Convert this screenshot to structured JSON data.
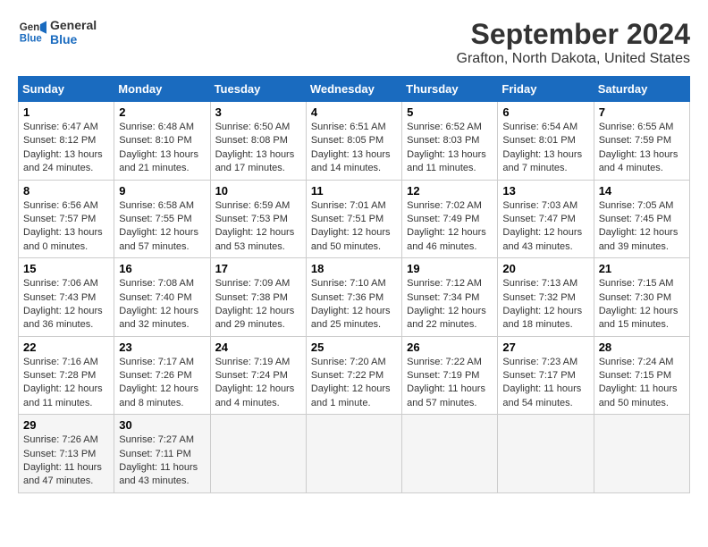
{
  "header": {
    "logo_line1": "General",
    "logo_line2": "Blue",
    "title": "September 2024",
    "subtitle": "Grafton, North Dakota, United States"
  },
  "days_of_week": [
    "Sunday",
    "Monday",
    "Tuesday",
    "Wednesday",
    "Thursday",
    "Friday",
    "Saturday"
  ],
  "weeks": [
    [
      {
        "day": "1",
        "info": "Sunrise: 6:47 AM\nSunset: 8:12 PM\nDaylight: 13 hours\nand 24 minutes."
      },
      {
        "day": "2",
        "info": "Sunrise: 6:48 AM\nSunset: 8:10 PM\nDaylight: 13 hours\nand 21 minutes."
      },
      {
        "day": "3",
        "info": "Sunrise: 6:50 AM\nSunset: 8:08 PM\nDaylight: 13 hours\nand 17 minutes."
      },
      {
        "day": "4",
        "info": "Sunrise: 6:51 AM\nSunset: 8:05 PM\nDaylight: 13 hours\nand 14 minutes."
      },
      {
        "day": "5",
        "info": "Sunrise: 6:52 AM\nSunset: 8:03 PM\nDaylight: 13 hours\nand 11 minutes."
      },
      {
        "day": "6",
        "info": "Sunrise: 6:54 AM\nSunset: 8:01 PM\nDaylight: 13 hours\nand 7 minutes."
      },
      {
        "day": "7",
        "info": "Sunrise: 6:55 AM\nSunset: 7:59 PM\nDaylight: 13 hours\nand 4 minutes."
      }
    ],
    [
      {
        "day": "8",
        "info": "Sunrise: 6:56 AM\nSunset: 7:57 PM\nDaylight: 13 hours\nand 0 minutes."
      },
      {
        "day": "9",
        "info": "Sunrise: 6:58 AM\nSunset: 7:55 PM\nDaylight: 12 hours\nand 57 minutes."
      },
      {
        "day": "10",
        "info": "Sunrise: 6:59 AM\nSunset: 7:53 PM\nDaylight: 12 hours\nand 53 minutes."
      },
      {
        "day": "11",
        "info": "Sunrise: 7:01 AM\nSunset: 7:51 PM\nDaylight: 12 hours\nand 50 minutes."
      },
      {
        "day": "12",
        "info": "Sunrise: 7:02 AM\nSunset: 7:49 PM\nDaylight: 12 hours\nand 46 minutes."
      },
      {
        "day": "13",
        "info": "Sunrise: 7:03 AM\nSunset: 7:47 PM\nDaylight: 12 hours\nand 43 minutes."
      },
      {
        "day": "14",
        "info": "Sunrise: 7:05 AM\nSunset: 7:45 PM\nDaylight: 12 hours\nand 39 minutes."
      }
    ],
    [
      {
        "day": "15",
        "info": "Sunrise: 7:06 AM\nSunset: 7:43 PM\nDaylight: 12 hours\nand 36 minutes."
      },
      {
        "day": "16",
        "info": "Sunrise: 7:08 AM\nSunset: 7:40 PM\nDaylight: 12 hours\nand 32 minutes."
      },
      {
        "day": "17",
        "info": "Sunrise: 7:09 AM\nSunset: 7:38 PM\nDaylight: 12 hours\nand 29 minutes."
      },
      {
        "day": "18",
        "info": "Sunrise: 7:10 AM\nSunset: 7:36 PM\nDaylight: 12 hours\nand 25 minutes."
      },
      {
        "day": "19",
        "info": "Sunrise: 7:12 AM\nSunset: 7:34 PM\nDaylight: 12 hours\nand 22 minutes."
      },
      {
        "day": "20",
        "info": "Sunrise: 7:13 AM\nSunset: 7:32 PM\nDaylight: 12 hours\nand 18 minutes."
      },
      {
        "day": "21",
        "info": "Sunrise: 7:15 AM\nSunset: 7:30 PM\nDaylight: 12 hours\nand 15 minutes."
      }
    ],
    [
      {
        "day": "22",
        "info": "Sunrise: 7:16 AM\nSunset: 7:28 PM\nDaylight: 12 hours\nand 11 minutes."
      },
      {
        "day": "23",
        "info": "Sunrise: 7:17 AM\nSunset: 7:26 PM\nDaylight: 12 hours\nand 8 minutes."
      },
      {
        "day": "24",
        "info": "Sunrise: 7:19 AM\nSunset: 7:24 PM\nDaylight: 12 hours\nand 4 minutes."
      },
      {
        "day": "25",
        "info": "Sunrise: 7:20 AM\nSunset: 7:22 PM\nDaylight: 12 hours\nand 1 minute."
      },
      {
        "day": "26",
        "info": "Sunrise: 7:22 AM\nSunset: 7:19 PM\nDaylight: 11 hours\nand 57 minutes."
      },
      {
        "day": "27",
        "info": "Sunrise: 7:23 AM\nSunset: 7:17 PM\nDaylight: 11 hours\nand 54 minutes."
      },
      {
        "day": "28",
        "info": "Sunrise: 7:24 AM\nSunset: 7:15 PM\nDaylight: 11 hours\nand 50 minutes."
      }
    ],
    [
      {
        "day": "29",
        "info": "Sunrise: 7:26 AM\nSunset: 7:13 PM\nDaylight: 11 hours\nand 47 minutes."
      },
      {
        "day": "30",
        "info": "Sunrise: 7:27 AM\nSunset: 7:11 PM\nDaylight: 11 hours\nand 43 minutes."
      },
      {
        "day": "",
        "info": ""
      },
      {
        "day": "",
        "info": ""
      },
      {
        "day": "",
        "info": ""
      },
      {
        "day": "",
        "info": ""
      },
      {
        "day": "",
        "info": ""
      }
    ]
  ]
}
